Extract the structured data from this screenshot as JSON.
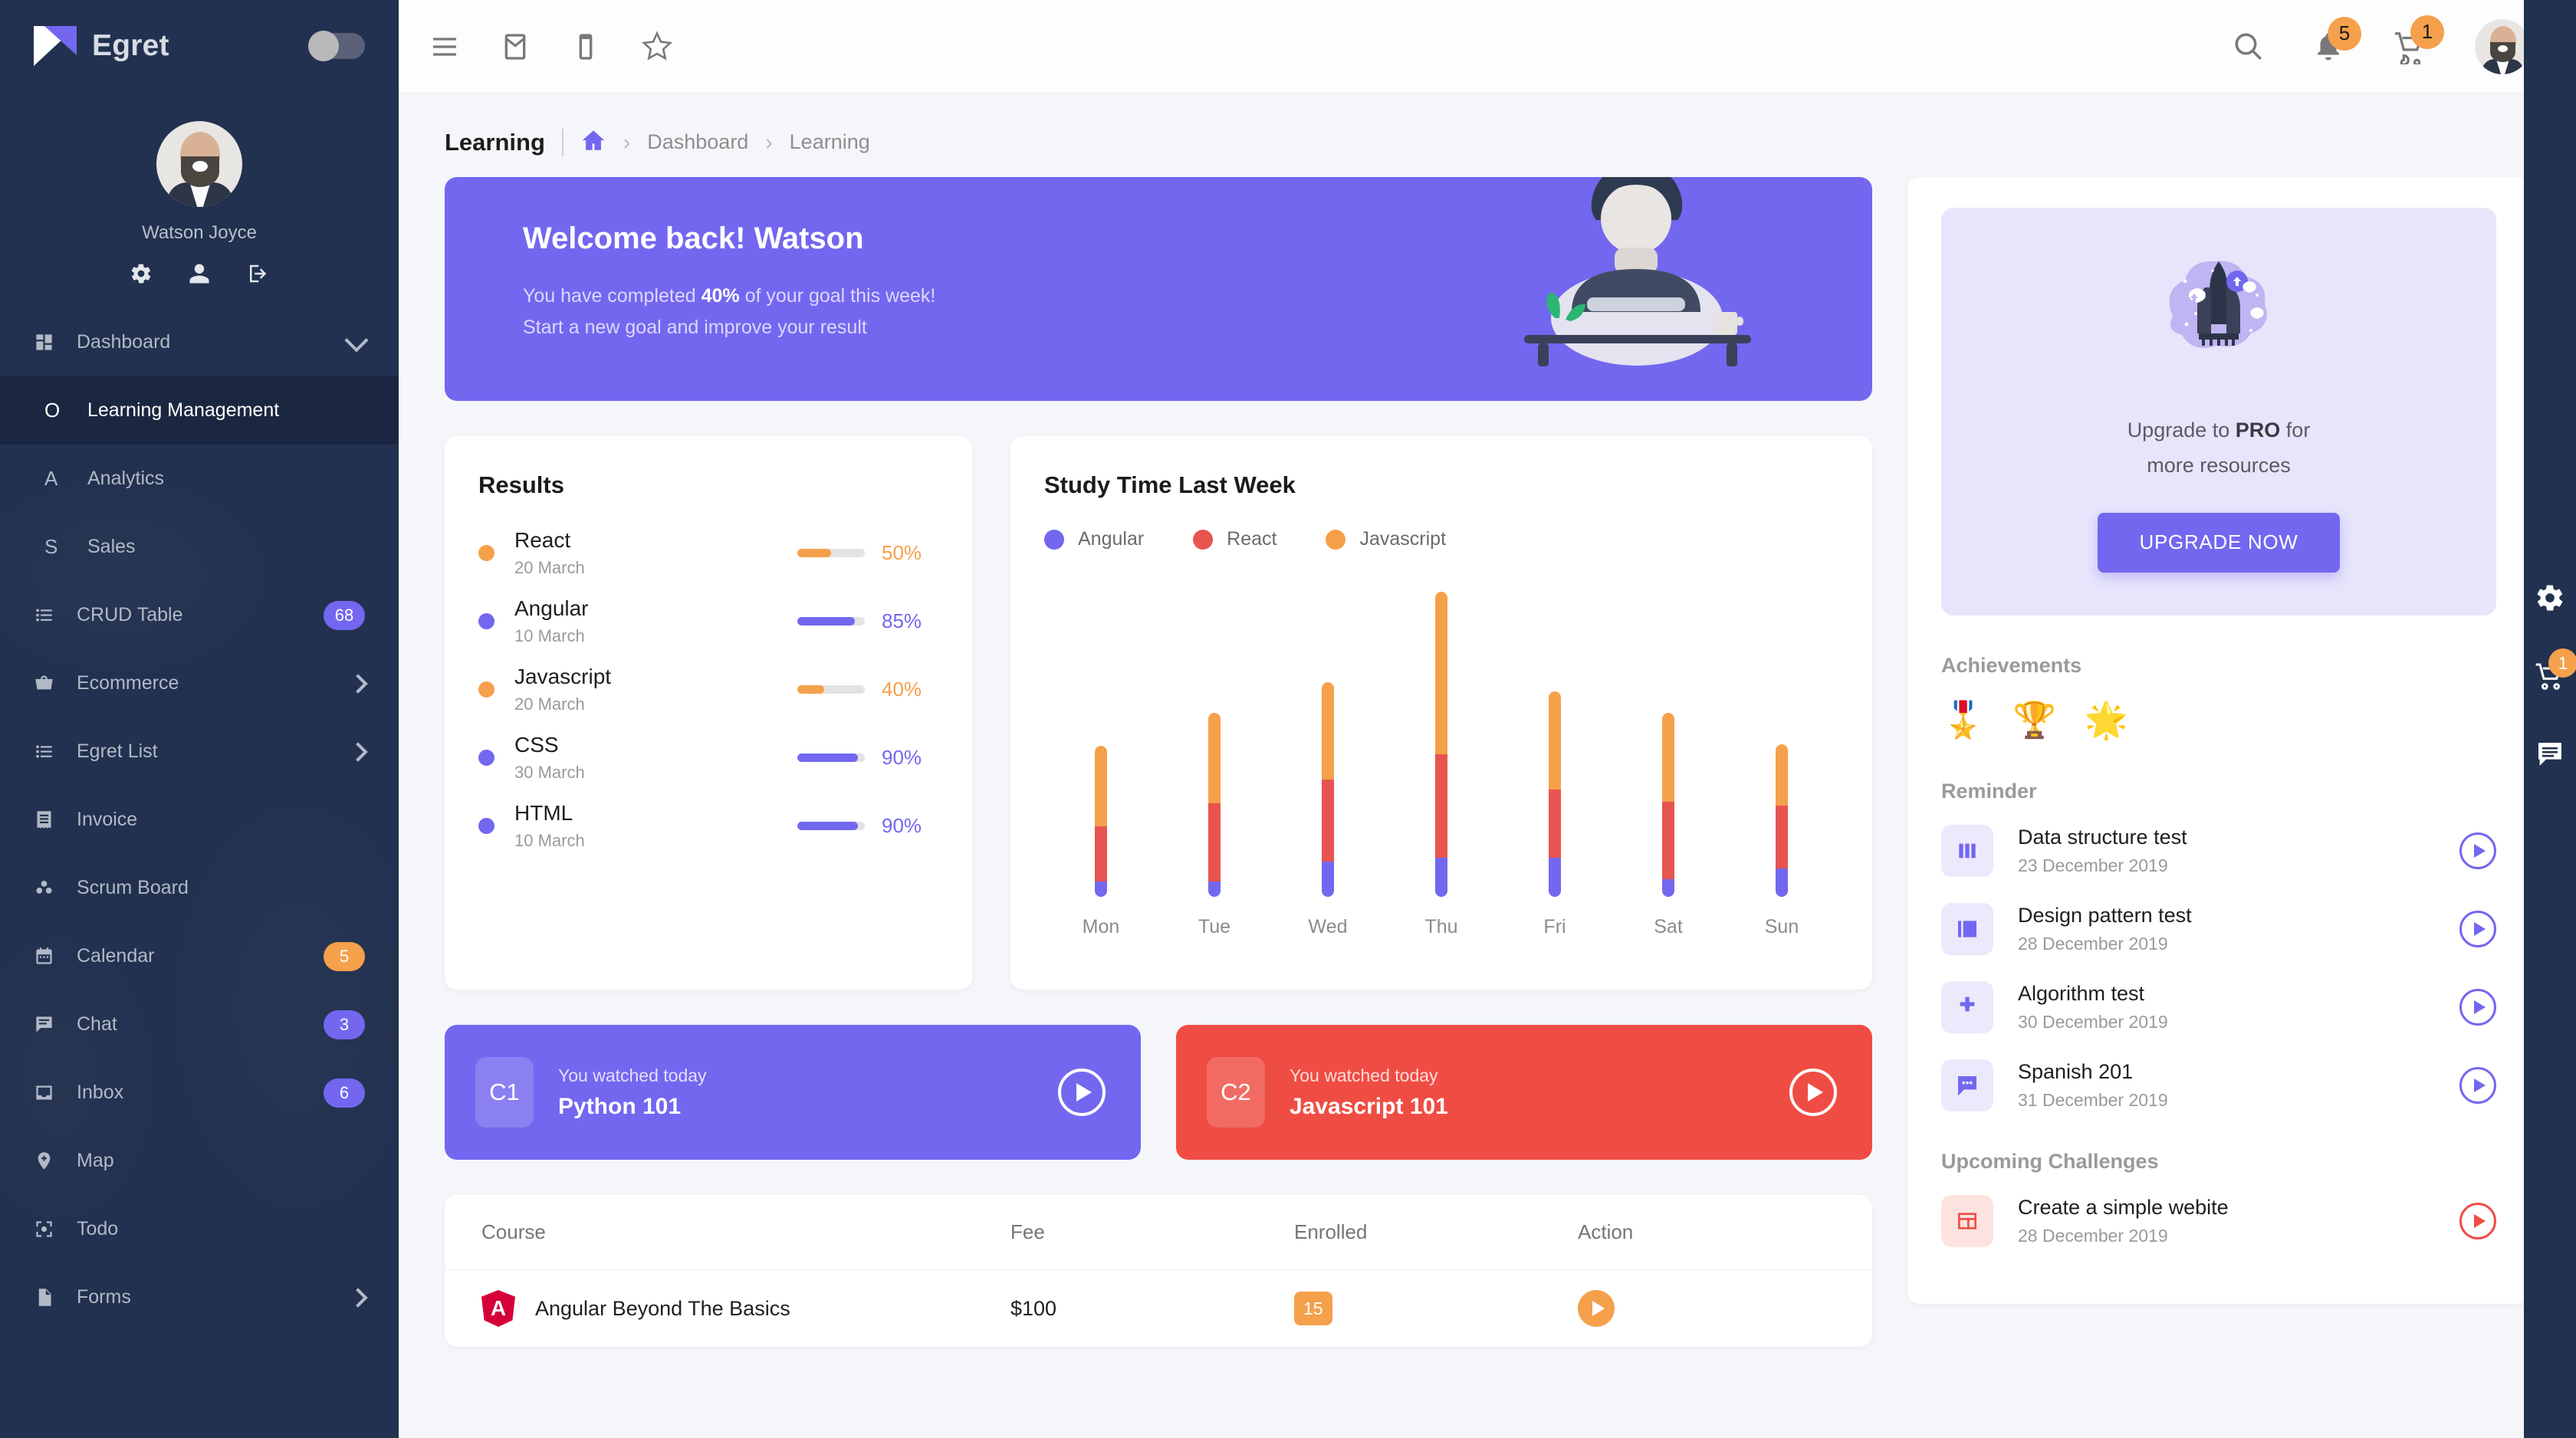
{
  "sidebar": {
    "brand": "Egret",
    "profile_name": "Watson Joyce",
    "profile_actions": [
      "gear-icon",
      "person-icon",
      "logout-icon"
    ],
    "items": [
      {
        "label": "Dashboard",
        "icon": "grid-icon",
        "type": "group",
        "chevron": "down"
      },
      {
        "label": "Learning Management",
        "icon": "O",
        "type": "sub",
        "active": true
      },
      {
        "label": "Analytics",
        "icon": "A",
        "type": "sub"
      },
      {
        "label": "Sales",
        "icon": "S",
        "type": "sub"
      },
      {
        "label": "CRUD Table",
        "icon": "list-icon",
        "badge": "68",
        "badge_color": "purple"
      },
      {
        "label": "Ecommerce",
        "icon": "basket-icon",
        "chevron": "right"
      },
      {
        "label": "Egret List",
        "icon": "list-icon",
        "chevron": "right"
      },
      {
        "label": "Invoice",
        "icon": "receipt-icon"
      },
      {
        "label": "Scrum Board",
        "icon": "scrum-icon"
      },
      {
        "label": "Calendar",
        "icon": "calendar-icon",
        "badge": "5",
        "badge_color": "orange"
      },
      {
        "label": "Chat",
        "icon": "chat-icon",
        "badge": "3",
        "badge_color": "purple"
      },
      {
        "label": "Inbox",
        "icon": "inbox-icon",
        "badge": "6",
        "badge_color": "purple"
      },
      {
        "label": "Map",
        "icon": "map-pin-icon"
      },
      {
        "label": "Todo",
        "icon": "todo-icon"
      },
      {
        "label": "Forms",
        "icon": "file-icon",
        "chevron": "right"
      }
    ]
  },
  "topbar": {
    "left_icons": [
      "menu-icon",
      "mail-icon",
      "device-icon",
      "star-icon"
    ],
    "search_icon": "search-icon",
    "notification_count": "5",
    "cart_count": "1"
  },
  "breadcrumb": {
    "title": "Learning",
    "home_icon": "home-icon",
    "items": [
      "Dashboard",
      "Learning"
    ]
  },
  "banner": {
    "heading": "Welcome back! Watson",
    "line1_pre": "You have completed ",
    "line1_bold": "40%",
    "line1_post": " of your goal this week!",
    "line2": "Start a new goal and improve your result"
  },
  "results": {
    "title": "Results",
    "rows": [
      {
        "name": "React",
        "date": "20 March",
        "pct": "50%",
        "value": 50,
        "color": "#f5a04b"
      },
      {
        "name": "Angular",
        "date": "10 March",
        "pct": "85%",
        "value": 85,
        "color": "#7367f0"
      },
      {
        "name": "Javascript",
        "date": "20 March",
        "pct": "40%",
        "value": 40,
        "color": "#f5a04b"
      },
      {
        "name": "CSS",
        "date": "30 March",
        "pct": "90%",
        "value": 90,
        "color": "#7367f0"
      },
      {
        "name": "HTML",
        "date": "10 March",
        "pct": "90%",
        "value": 90,
        "color": "#7367f0"
      }
    ]
  },
  "chart_data": {
    "type": "bar",
    "title": "Study Time Last Week",
    "stacked": true,
    "categories": [
      "Mon",
      "Tue",
      "Wed",
      "Thu",
      "Fri",
      "Sat",
      "Sun"
    ],
    "series": [
      {
        "name": "Angular",
        "color": "#7367f0",
        "values": [
          11,
          11,
          26,
          29,
          29,
          13,
          21
        ]
      },
      {
        "name": "React",
        "color": "#e8544f",
        "values": [
          41,
          58,
          60,
          76,
          50,
          57,
          46
        ]
      },
      {
        "name": "Javascript",
        "color": "#f5a04b",
        "values": [
          59,
          66,
          72,
          119,
          72,
          65,
          45
        ]
      }
    ],
    "xlabel": "",
    "ylabel": "",
    "grid": false,
    "legend_position": "top-left",
    "ylim": [
      0,
      240
    ]
  },
  "watched": [
    {
      "chip": "C1",
      "subtitle": "You watched today",
      "title": "Python 101",
      "color": "#7367f0",
      "play_icon": "play-icon"
    },
    {
      "chip": "C2",
      "subtitle": "You watched today",
      "title": "Javascript 101",
      "color": "#ef4d44",
      "play_icon": "play-icon"
    }
  ],
  "course_table": {
    "headers": [
      "Course",
      "Fee",
      "Enrolled",
      "Action"
    ],
    "rows": [
      {
        "logo": "angular-logo",
        "course": "Angular Beyond The Basics",
        "fee": "$100",
        "enrolled": "15",
        "action": "play-icon"
      }
    ]
  },
  "pro": {
    "art": "rocket-icon",
    "text_pre": "Upgrade to ",
    "text_bold": "PRO",
    "text_post": " for",
    "text_line2": "more resources",
    "button": "UPGRADE NOW"
  },
  "achievements": {
    "heading": "Achievements",
    "icons": [
      "🎖️",
      "🏆",
      "🌟"
    ]
  },
  "reminder": {
    "heading": "Reminder",
    "items": [
      {
        "title": "Data structure test",
        "date": "23 December 2019",
        "icon": "columns-icon",
        "play_icon": "play-icon"
      },
      {
        "title": "Design pattern test",
        "date": "28 December 2019",
        "icon": "library-icon",
        "play_icon": "play-icon"
      },
      {
        "title": "Algorithm test",
        "date": "30 December 2019",
        "icon": "dpad-icon",
        "play_icon": "play-icon"
      },
      {
        "title": "Spanish 201",
        "date": "31 December 2019",
        "icon": "message-icon",
        "play_icon": "play-icon"
      }
    ]
  },
  "challenges": {
    "heading": "Upcoming Challenges",
    "items": [
      {
        "title": "Create a simple webite",
        "date": "28 December 2019",
        "icon": "layout-icon",
        "play_icon": "play-icon"
      }
    ]
  },
  "rail": {
    "gear_icon": "gear-icon",
    "cart_icon": "cart-icon",
    "cart_count": "1",
    "chat_icon": "chat-icon"
  }
}
